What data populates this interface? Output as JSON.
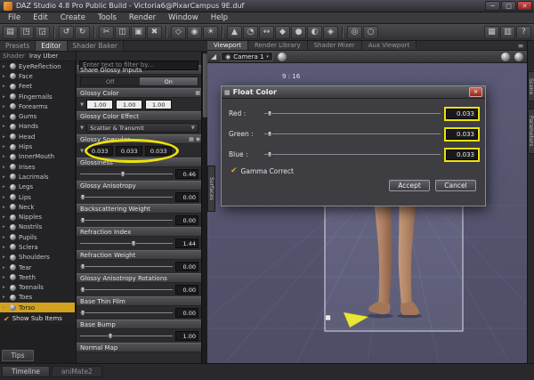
{
  "window": {
    "title": "DAZ Studio 4.8 Pro Public Build - Victoria6@PixarCampus 9E.duf",
    "minimize_glyph": "─",
    "maximize_glyph": "□",
    "close_glyph": "✕"
  },
  "menu": {
    "items": [
      "File",
      "Edit",
      "Create",
      "Tools",
      "Render",
      "Window",
      "Help"
    ]
  },
  "toolbar": {
    "groups": [
      [
        {
          "name": "new-file-icon",
          "glyph": "▤"
        },
        {
          "name": "open-file-icon",
          "glyph": "◳"
        },
        {
          "name": "save-file-icon",
          "glyph": "◲"
        }
      ],
      [
        {
          "name": "undo-icon",
          "glyph": "↺"
        },
        {
          "name": "redo-icon",
          "glyph": "↻"
        }
      ],
      [
        {
          "name": "cut-icon",
          "glyph": "✂"
        },
        {
          "name": "copy-icon",
          "glyph": "◫"
        },
        {
          "name": "paste-icon",
          "glyph": "▣"
        },
        {
          "name": "delete-icon",
          "glyph": "✖"
        }
      ],
      [
        {
          "name": "create-null-icon",
          "glyph": "◇"
        },
        {
          "name": "create-camera-icon",
          "glyph": "◉"
        },
        {
          "name": "create-light-icon",
          "glyph": "☀"
        }
      ],
      [
        {
          "name": "node-selection-tool-icon",
          "glyph": "▲"
        },
        {
          "name": "rotate-tool-icon",
          "glyph": "◔"
        },
        {
          "name": "translate-tool-icon",
          "glyph": "↔"
        },
        {
          "name": "scale-tool-icon",
          "glyph": "◆"
        },
        {
          "name": "active-pose-tool-icon",
          "glyph": "●"
        },
        {
          "name": "surface-selection-tool-icon",
          "glyph": "◐"
        },
        {
          "name": "region-navigator-icon",
          "glyph": "◈"
        }
      ],
      [
        {
          "name": "render-icon",
          "glyph": "◎"
        },
        {
          "name": "render-settings-icon",
          "glyph": "○"
        }
      ]
    ],
    "right_icons": [
      {
        "name": "layout-icon",
        "glyph": "▦"
      },
      {
        "name": "panes-icon",
        "glyph": "▥"
      },
      {
        "name": "help-icon",
        "glyph": "?"
      }
    ]
  },
  "left_tabs": {
    "items": [
      {
        "label": "Presets",
        "active": false
      },
      {
        "label": "Editor",
        "active": true
      },
      {
        "label": "Shader Baker",
        "active": false
      }
    ]
  },
  "shader_bar": {
    "label": "Shader",
    "value": "Iray Uber"
  },
  "sidebar": {
    "surfaces": [
      "EyeReflection",
      "Face",
      "Feet",
      "Fingernails",
      "Forearms",
      "Gums",
      "Hands",
      "Head",
      "Hips",
      "InnerMouth",
      "Irises",
      "Lacrimals",
      "Legs",
      "Lips",
      "Neck",
      "Nipples",
      "Nostrils",
      "Pupils",
      "Sclera",
      "Shoulders",
      "Tear",
      "Teeth",
      "Toenails",
      "Toes",
      "Torso"
    ],
    "selected": "Torso",
    "expand_glyph": "▸",
    "check_glyph": "✔",
    "show_sub_items_label": "Show Sub Items"
  },
  "tips_label": "Tips",
  "properties": {
    "filter_placeholder": "Enter text to filter by...",
    "groups": [
      {
        "label": "Share Glossy Inputs",
        "type": "toggle",
        "off": "Off",
        "on": "On",
        "active": "On"
      },
      {
        "label": "Glossy Color",
        "type": "color3",
        "values": [
          "1.00",
          "1.00",
          "1.00"
        ],
        "swatch": "light",
        "header_icons": [
          {
            "name": "image-map-icon",
            "glyph": "▦"
          },
          {
            "name": "menu-icon",
            "glyph": "▾"
          }
        ]
      },
      {
        "label": "Glossy Color Effect",
        "type": "dropdown",
        "value": "Scatter & Transmit"
      },
      {
        "label": "Glossy Specular",
        "type": "color3",
        "values": [
          "0.033",
          "0.033",
          "0.033"
        ],
        "swatch": "dark",
        "header_icons": [
          {
            "name": "image-map-icon",
            "glyph": "▦"
          },
          {
            "name": "color-wheel-icon",
            "glyph": "◉"
          },
          {
            "name": "menu-icon",
            "glyph": "▾"
          }
        ]
      },
      {
        "label": "Glossiness",
        "type": "slider",
        "value": "0.46",
        "percent": 46
      },
      {
        "label": "Glossy Anisotropy",
        "type": "slider",
        "value": "0.00",
        "percent": 3
      },
      {
        "label": "Backscattering Weight",
        "type": "slider",
        "value": "0.00",
        "percent": 3
      },
      {
        "label": "Refraction Index",
        "type": "slider",
        "value": "1.44",
        "percent": 58
      },
      {
        "label": "Refraction Weight",
        "type": "slider",
        "value": "0.00",
        "percent": 3
      },
      {
        "label": "Glossy Anisotropy Rotations",
        "type": "slider",
        "value": "0.00",
        "percent": 3
      },
      {
        "label": "Base Thin Film",
        "type": "slider",
        "value": "0.00",
        "percent": 3
      },
      {
        "label": "Base Bump",
        "type": "slider",
        "value": "1.00",
        "percent": 33
      },
      {
        "label": "Normal Map",
        "type": "header"
      }
    ]
  },
  "viewport": {
    "tabs": [
      {
        "label": "Viewport",
        "active": true
      },
      {
        "label": "Render Library",
        "active": false
      },
      {
        "label": "Shader Mixer",
        "active": false
      },
      {
        "label": "Aux Viewport",
        "active": false
      }
    ],
    "menu_icon_glyph": "≡",
    "nav_icon_glyph": "◢",
    "camera_icon_glyph": "◉",
    "camera_label": "Camera 1",
    "camera_caret": "▾",
    "aspect_label": "9 : 16",
    "left_side_tab": "Surfaces",
    "right_side_tabs": [
      "Scene",
      "Parameters"
    ]
  },
  "dialog": {
    "title": "Float Color",
    "icon_glyph": "▦",
    "close_glyph": "✕",
    "fields": [
      {
        "label": "Red :",
        "value": "0.033",
        "percent": 3
      },
      {
        "label": "Green :",
        "value": "0.033",
        "percent": 3
      },
      {
        "label": "Blue :",
        "value": "0.033",
        "percent": 3
      }
    ],
    "check_glyph": "✔",
    "gamma_label": "Gamma Correct",
    "accept_label": "Accept",
    "cancel_label": "Cancel"
  },
  "bottom": {
    "tabs": [
      {
        "label": "Timeline",
        "active": true
      },
      {
        "label": "aniMate2",
        "active": false
      }
    ]
  },
  "colors": {
    "selection_orange": "#d2a21f",
    "annotation_yellow": "#ece20a",
    "viewport_background": "#63637f"
  }
}
